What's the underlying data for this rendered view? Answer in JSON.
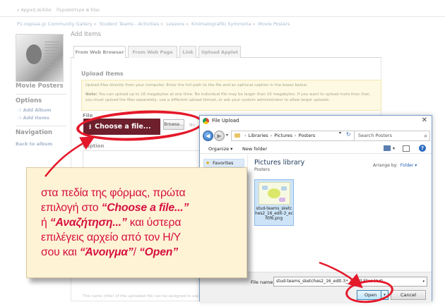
{
  "topbar": {
    "left_text": "« Αρχική σελίδα",
    "right_text": "Περισσότερα ⊕ Εδώ"
  },
  "breadcrumb": [
    "P1.ospsaa.gr Community Gallery",
    "Student Teams - Activities",
    "Lessons",
    "Kinimatografiki Symmoria",
    "Movie Posters"
  ],
  "album": {
    "title": "Movie Posters"
  },
  "sidebar": {
    "options_heading": "Options",
    "links": [
      "Add Album",
      "Add Items"
    ],
    "navigation_heading": "Navigation",
    "back_link": "Back to album"
  },
  "content": {
    "heading": "Add Items",
    "tabs": [
      {
        "label": "From Web Browser"
      },
      {
        "label": "From Web Page"
      },
      {
        "label": "Link"
      },
      {
        "label": "Upload Applet"
      }
    ],
    "upload_heading": "Upload Items",
    "help_text_1": "Upload files directly from your computer. Enter the full path to the file and an optional caption in the boxes below.",
    "help_note_label": "Note:",
    "help_text_2": "You can upload up to 16 megabytes at one time. No individual file may be larger than 16 megabytes. If you want to upload more than that, you must upload the files separately, use a different upload format, or ask your system administrator to allow larger uploads.",
    "file_label": "File",
    "choose_label": "Choose a file...",
    "browse_label": "Browse...",
    "no_file_label": "No",
    "caption_label": "Caption",
    "footnote": "The name (title) of the uploaded file can be assigned to each item"
  },
  "dialog": {
    "title": "File Upload",
    "path": [
      "Libraries",
      "Pictures",
      "Posters"
    ],
    "search_placeholder": "Search Posters",
    "organize_label": "Organize ▾",
    "new_folder_label": "New folder",
    "nav_favorites": "Favorites",
    "library_title": "Pictures library",
    "library_subtitle": "Posters",
    "arrange_label": "Arrange by:",
    "arrange_value": "Folder ▾",
    "file_item_name": "stud-teams_sketches2_16_edit-3_ecf0f6.png",
    "filename_label": "File name:",
    "filename_value": "stud-teams_sketches2_16_edit-3_",
    "filetype_value": "All Files (*.*)",
    "open_label": "Open",
    "cancel_label": "Cancel"
  },
  "callout": {
    "line1": "στα πεδία της φόρμας, πρώτα",
    "line2_pre": "επιλογή στο ",
    "line2_em": "“Choose a file...”",
    "line3_pre": "ή ",
    "line3_em": "“Αναζήτηση...”",
    "line3_post": " και ύστερα",
    "line4": "επιλέγεις αρχείο από τον Η/Υ",
    "line5_pre": "σου και ",
    "line5_em1": "“Άνοιγμα”",
    "line5_sep": "/ ",
    "line5_em2": "“Open”"
  },
  "colors": {
    "accent_red": "#e5182a",
    "button_maroon": "#6d1f2c",
    "callout_bg": "#fff3d6",
    "callout_text": "#d5103f"
  }
}
